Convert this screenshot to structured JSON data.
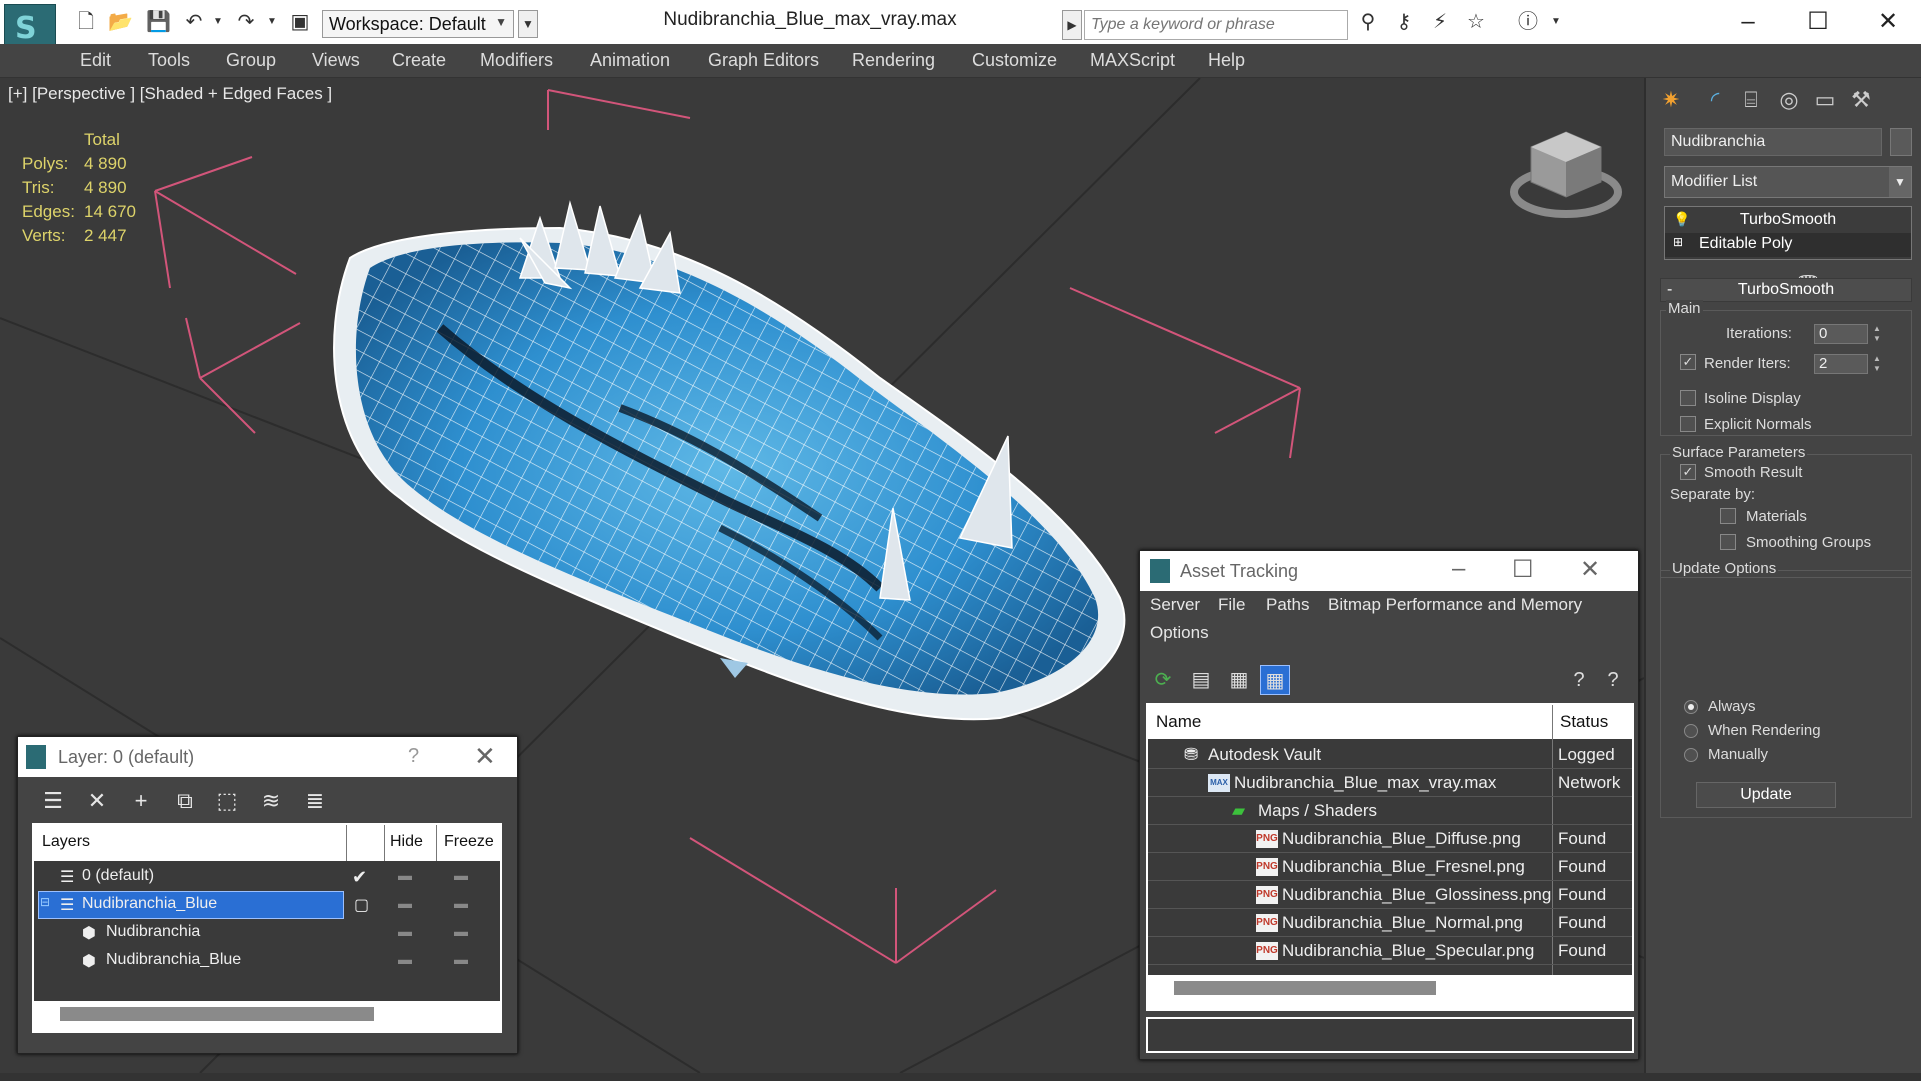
{
  "titlebar": {
    "title": "Nudibranchia_Blue_max_vray.max",
    "workspace": "Workspace: Default",
    "search_placeholder": "Type a keyword or phrase"
  },
  "menu": [
    "Edit",
    "Tools",
    "Group",
    "Views",
    "Create",
    "Modifiers",
    "Animation",
    "Graph Editors",
    "Rendering",
    "Customize",
    "MAXScript",
    "Help"
  ],
  "viewport": {
    "label": "[+] [Perspective ] [Shaded + Edged Faces ]",
    "stats": {
      "header": "Total",
      "rows": [
        {
          "label": "Polys:",
          "value": "4 890"
        },
        {
          "label": "Tris:",
          "value": "4 890"
        },
        {
          "label": "Edges:",
          "value": "14 670"
        },
        {
          "label": "Verts:",
          "value": "2 447"
        }
      ]
    }
  },
  "command_panel": {
    "object_name": "Nudibranchia",
    "modifier_list": "Modifier List",
    "stack": [
      "TurboSmooth",
      "Editable Poly"
    ],
    "rollout_title": "TurboSmooth",
    "main_group": "Main",
    "iterations_label": "Iterations:",
    "iterations_value": "0",
    "render_iters_label": "Render Iters:",
    "render_iters_value": "2",
    "render_iters_checked": true,
    "isoline_label": "Isoline Display",
    "explicit_normals_label": "Explicit Normals",
    "surface_group": "Surface Parameters",
    "smooth_result_label": "Smooth Result",
    "separate_by_label": "Separate by:",
    "materials_label": "Materials",
    "smoothing_groups_label": "Smoothing Groups",
    "update_group": "Update Options",
    "update_options": [
      {
        "label": "Always",
        "selected": true
      },
      {
        "label": "When Rendering",
        "selected": false
      },
      {
        "label": "Manually",
        "selected": false
      }
    ],
    "update_button": "Update"
  },
  "layer_dialog": {
    "title": "Layer: 0 (default)",
    "help": "?",
    "columns": {
      "layers": "Layers",
      "hide": "Hide",
      "freeze": "Freeze"
    },
    "rows": [
      {
        "name": "0 (default)",
        "active": true
      },
      {
        "name": "Nudibranchia_Blue",
        "selected": true
      },
      {
        "name": "Nudibranchia"
      },
      {
        "name": "Nudibranchia_Blue"
      }
    ]
  },
  "asset_dialog": {
    "title": "Asset Tracking",
    "menu": [
      "Server",
      "File",
      "Paths",
      "Bitmap Performance and Memory",
      "Options"
    ],
    "columns": {
      "name": "Name",
      "status": "Status"
    },
    "rows": [
      {
        "name": "Autodesk Vault",
        "status": "Logged"
      },
      {
        "name": "Nudibranchia_Blue_max_vray.max",
        "status": "Network"
      },
      {
        "name": "Maps / Shaders",
        "status": ""
      },
      {
        "name": "Nudibranchia_Blue_Diffuse.png",
        "status": "Found"
      },
      {
        "name": "Nudibranchia_Blue_Fresnel.png",
        "status": "Found"
      },
      {
        "name": "Nudibranchia_Blue_Glossiness.png",
        "status": "Found"
      },
      {
        "name": "Nudibranchia_Blue_Normal.png",
        "status": "Found"
      },
      {
        "name": "Nudibranchia_Blue_Specular.png",
        "status": "Found"
      }
    ],
    "icon_labels": {
      "max": "MAX",
      "png": "PNG"
    }
  }
}
